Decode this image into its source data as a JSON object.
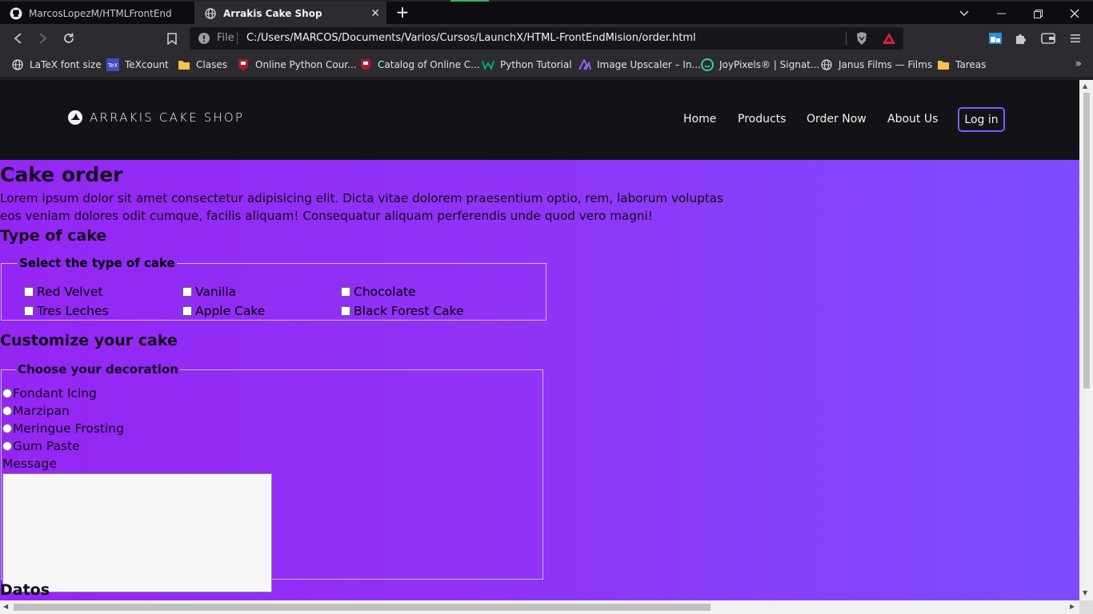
{
  "browser": {
    "tabs": [
      {
        "title": "MarcosLopezM/HTMLFrontEnd",
        "icon": "github-icon"
      },
      {
        "title": "Arrakis Cake Shop",
        "icon": "globe-icon",
        "active": true
      }
    ],
    "address": {
      "scheme_label": "File",
      "url": "C:/Users/MARCOS/Documents/Varios/Cursos/LaunchX/HTML-FrontEndMision/order.html"
    },
    "bookmarks": [
      {
        "label": "LaTeX font size",
        "icon": "globe-icon"
      },
      {
        "label": "TeXcount",
        "icon": "texcount-icon"
      },
      {
        "label": "Clases",
        "icon": "folder-icon"
      },
      {
        "label": "Online Python Cour...",
        "icon": "harvard-icon"
      },
      {
        "label": "Catalog of Online C...",
        "icon": "harvard-icon"
      },
      {
        "label": "Python Tutorial",
        "icon": "w3-icon"
      },
      {
        "label": "Image Upscaler – In...",
        "icon": "upscaler-icon"
      },
      {
        "label": "JoyPixels® | Signat...",
        "icon": "joypixels-icon"
      },
      {
        "label": "Janus Films — Films",
        "icon": "globe-icon"
      },
      {
        "label": "Tareas",
        "icon": "folder-icon"
      }
    ]
  },
  "site": {
    "logo_text": "ARRAKIS CAKE SHOP",
    "nav": [
      "Home",
      "Products",
      "Order Now",
      "About Us"
    ],
    "login_label": "Log in"
  },
  "order": {
    "title": "Cake order",
    "intro": "Lorem ipsum dolor sit amet consectetur adipisicing elit. Dicta vitae dolorem praesentium optio, rem, laborum voluptas eos veniam dolores odit cumque, facilis aliquam! Consequatur aliquam perferendis unde quod vero magni!",
    "type_heading": "Type of cake",
    "type_legend": "Select the type of cake",
    "cake_types": [
      "Red Velvet",
      "Vanilla",
      "Chocolate",
      "Tres Leches",
      "Apple Cake",
      "Black Forest Cake"
    ],
    "custom_heading": "Customize your cake",
    "decoration_legend": "Choose your decoration",
    "decorations": [
      "Fondant Icing",
      "Marzipan",
      "Meringue Frosting",
      "Gum Paste"
    ],
    "message_label": "Message",
    "message_value": "",
    "datos_heading": "Datos"
  },
  "colors": {
    "header_bg": "#131317",
    "gradient_start": "#9426f4",
    "gradient_end": "#7b4dff",
    "login_border": "#7d5cff"
  }
}
